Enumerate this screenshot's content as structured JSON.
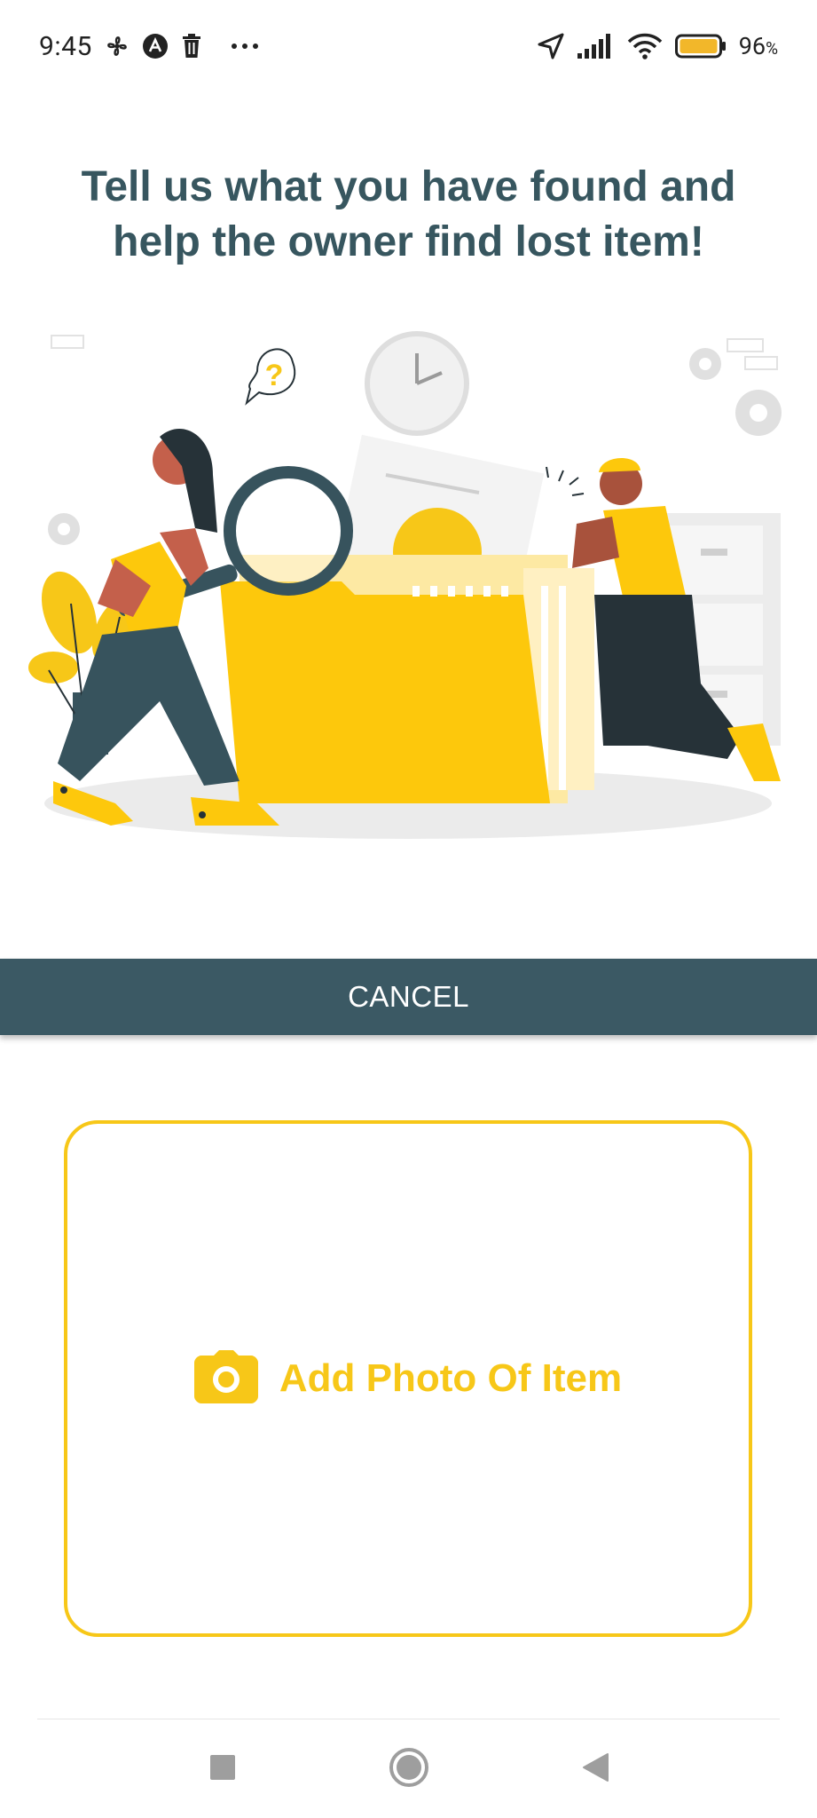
{
  "status_bar": {
    "time": "9:45",
    "battery_percent": "96",
    "battery_unit": "%",
    "icons": [
      "fan-icon",
      "a-badge-icon",
      "trash-icon",
      "more-dots-icon",
      "location-arrow-icon",
      "signal-icon",
      "wifi-icon",
      "battery-icon"
    ]
  },
  "header": {
    "title_line1": "Tell us what you have found and",
    "title_line2": "help the owner find lost item!"
  },
  "illustration": {
    "question_mark": "?"
  },
  "actions": {
    "cancel_label": "CANCEL"
  },
  "photo_picker": {
    "label": "Add Photo Of Item",
    "icon": "camera-icon"
  },
  "nav_bar": {
    "buttons": [
      "recents-square-icon",
      "home-circle-icon",
      "back-triangle-icon"
    ]
  },
  "colors": {
    "primary_dark": "#3b5964",
    "title_text": "#37565f",
    "accent_yellow": "#f7c718"
  }
}
